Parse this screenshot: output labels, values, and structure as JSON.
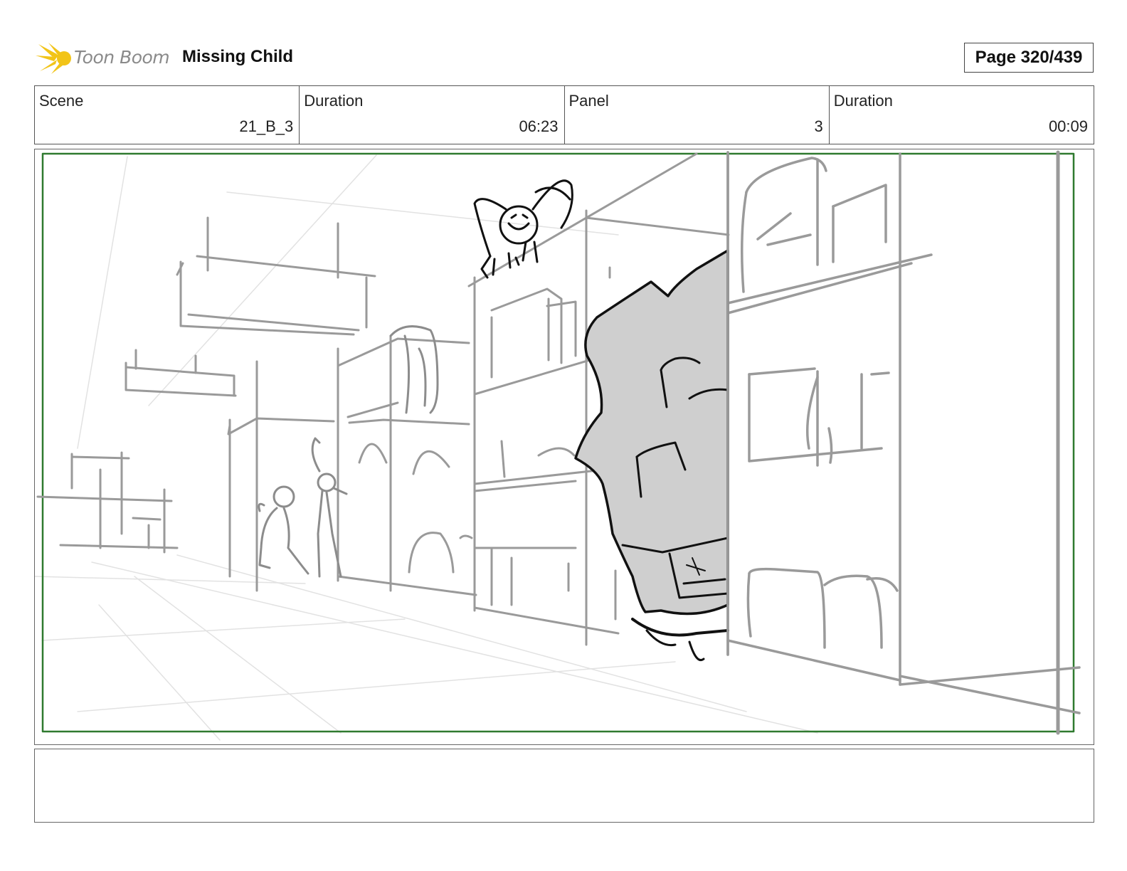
{
  "header": {
    "logo_text": "Toon Boom",
    "title": "Missing Child",
    "page_label": "Page 320/439"
  },
  "info": {
    "scene_label": "Scene",
    "scene_value": "21_B_3",
    "scene_duration_label": "Duration",
    "scene_duration_value": "06:23",
    "panel_label": "Panel",
    "panel_value": "3",
    "panel_duration_label": "Duration",
    "panel_duration_value": "00:09"
  },
  "colors": {
    "safe_frame": "#2f7a2f",
    "logo_yellow": "#f2c418",
    "sketch_gray": "#9a9a9a",
    "rock_fill": "#cfcfcf"
  }
}
